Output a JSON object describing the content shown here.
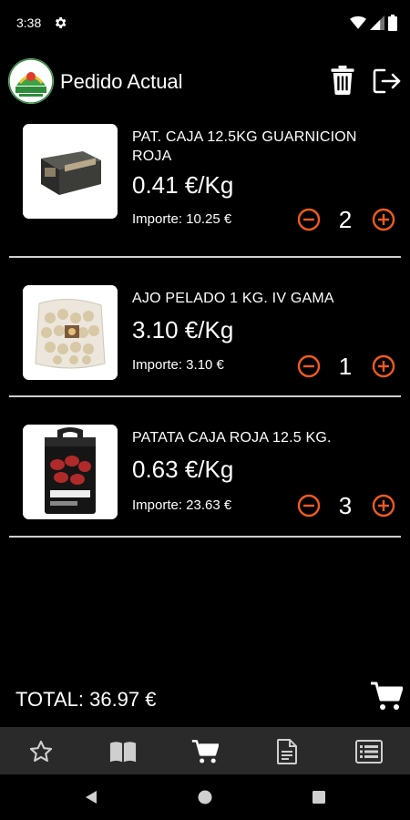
{
  "status_bar": {
    "time": "3:38",
    "icons": [
      "gear-icon",
      "wifi-icon",
      "signal-icon",
      "battery-icon"
    ]
  },
  "app_bar": {
    "title": "Pedido Actual",
    "logo": "app-logo",
    "actions": [
      "trash-icon",
      "logout-icon"
    ]
  },
  "order": {
    "items": [
      {
        "name": "PAT. CAJA 12.5KG GUARNICION ROJA",
        "price": "0.41 €/Kg",
        "importe": "Importe: 10.25 €",
        "quantity": "2"
      },
      {
        "name": "AJO PELADO 1 KG. IV GAMA",
        "price": "3.10 €/Kg",
        "importe": "Importe: 3.10 €",
        "quantity": "1"
      },
      {
        "name": "PATATA CAJA ROJA 12.5 KG.",
        "price": "0.63 €/Kg",
        "importe": "Importe: 23.63 €",
        "quantity": "3"
      }
    ],
    "total": "TOTAL: 36.97 €"
  },
  "bottom_nav": {
    "items": [
      "star-icon",
      "book-icon",
      "cart-icon",
      "document-icon",
      "list-icon"
    ],
    "active": "cart-icon"
  },
  "colors": {
    "background": "#000000",
    "accent": "#f25a1d",
    "nav_background": "#2a2a2a",
    "divider": "#cfcfcf"
  }
}
